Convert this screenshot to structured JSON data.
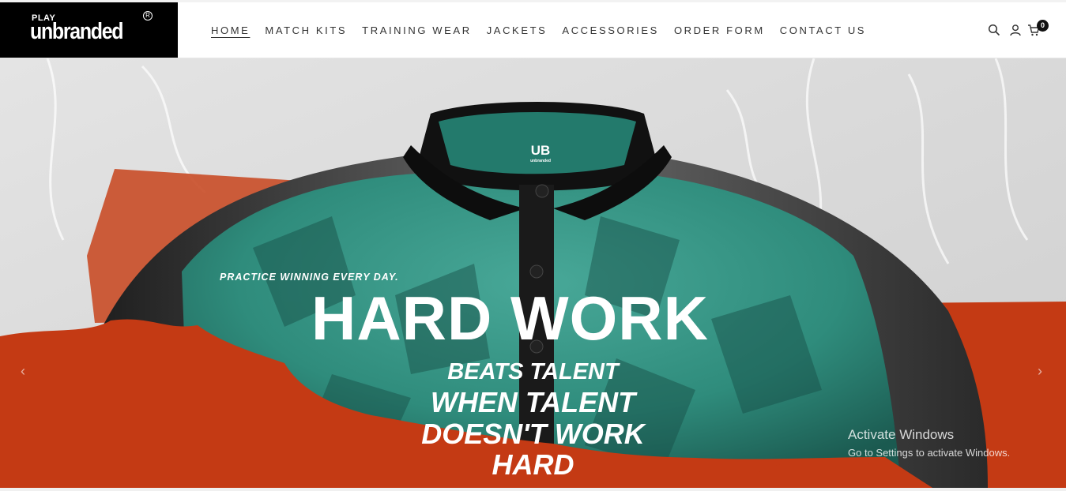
{
  "brand": {
    "small": "PLAY",
    "name": "unbranded",
    "reg": "R"
  },
  "nav": {
    "items": [
      {
        "label": "HOME",
        "active": true
      },
      {
        "label": "MATCH KITS"
      },
      {
        "label": "TRAINING WEAR"
      },
      {
        "label": "JACKETS"
      },
      {
        "label": "ACCESSORIES"
      },
      {
        "label": "ORDER FORM"
      },
      {
        "label": "CONTACT US"
      }
    ]
  },
  "header_icons": {
    "search": "search-icon",
    "account": "user-icon",
    "cart": "cart-icon",
    "cart_count": "0"
  },
  "hero": {
    "collar_logo": "UB",
    "collar_logo_sub": "unbranded",
    "tagline": "PRACTICE WINNING EVERY DAY.",
    "headline": "HARD WORK",
    "lines": [
      "BEATS TALENT",
      "WHEN TALENT",
      "DOESN'T WORK",
      "HARD"
    ]
  },
  "watermark": {
    "line1": "Activate Windows",
    "line2": "Go to Settings to activate Windows."
  },
  "colors": {
    "accent_orange": "#c43a14",
    "jersey_teal": "#2f8c7c",
    "logo_bg": "#000000"
  }
}
